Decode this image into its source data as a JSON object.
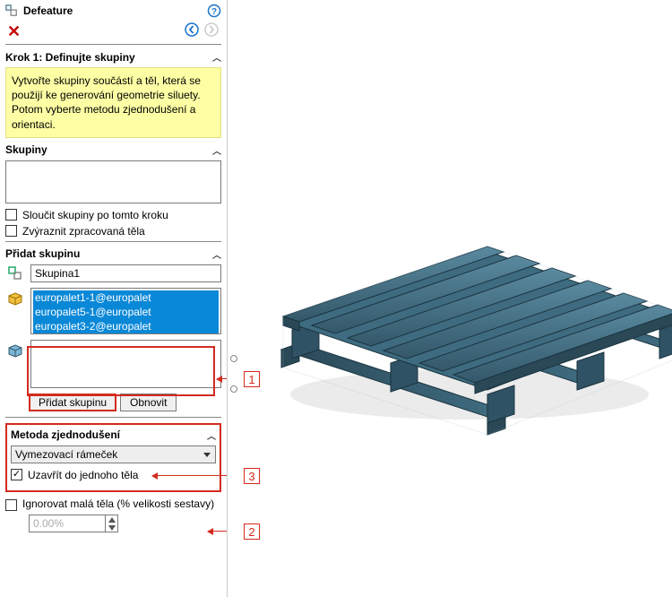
{
  "panel": {
    "title": "Defeature",
    "step_title": "Krok 1: Definujte skupiny",
    "info_text": "Vytvořte skupiny součástí a těl, která se použijí ke generování geometrie siluety. Potom vyberte metodu zjednodušení a orientaci.",
    "groups_header": "Skupiny",
    "merge_label": "Sloučit skupiny po tomto kroku",
    "highlight_label": "Zvýraznit zpracovaná těla",
    "add_group_header": "Přidat skupinu",
    "group_name_value": "Skupina1",
    "selection_items": [
      "europalet1-1@europalet",
      "europalet5-1@europalet",
      "europalet3-2@europalet"
    ],
    "add_button": "Přidat skupinu",
    "refresh_button": "Obnovit",
    "method_header": "Metoda zjednodušení",
    "method_value": "Vymezovací rámeček",
    "close_body_label": "Uzavřít do jednoho těla",
    "ignore_small_label": "Ignorovat malá těla (% velikosti sestavy)",
    "ignore_pct_value": "0.00%"
  },
  "callouts": {
    "n1": "1",
    "n2": "2",
    "n3": "3"
  },
  "colors": {
    "accent_red": "#d32b1f",
    "pallet": "#34586a",
    "pallet_top": "#4b7a91"
  }
}
